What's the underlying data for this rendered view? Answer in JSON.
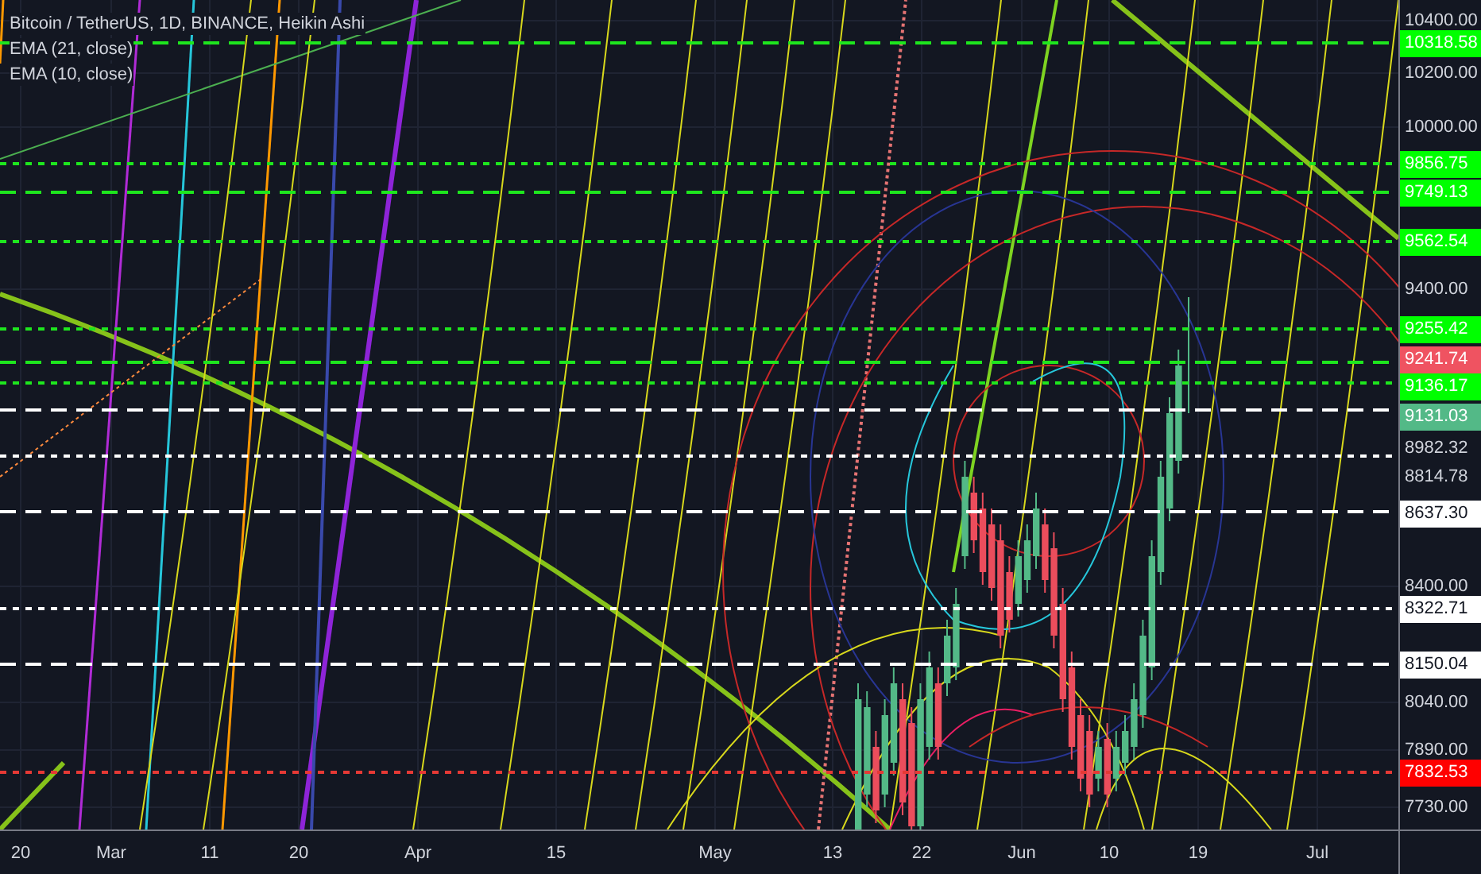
{
  "legend": [
    "Bitcoin / TetherUS, 1D, BINANCE, Heikin Ashi",
    "EMA (21, close)",
    "EMA (10, close)"
  ],
  "levels": [
    {
      "color": "#1ee61e",
      "kind": "thick"
    },
    {
      "color": "#1ee61e",
      "kind": "thin"
    },
    {
      "color": "#1ee61e",
      "kind": "thick"
    },
    {
      "color": "#1ee61e",
      "kind": "thin"
    },
    {
      "color": "#1ee61e",
      "kind": "thin"
    },
    {
      "color": "#1ee61e",
      "kind": "thick"
    },
    {
      "color": "#1ee61e",
      "kind": "thin"
    },
    {
      "color": "#ffffff",
      "kind": "thick"
    },
    {
      "color": "#ffffff",
      "kind": "thin"
    },
    {
      "color": "#ffffff",
      "kind": "thick"
    },
    {
      "color": "#ffffff",
      "kind": "thin"
    },
    {
      "color": "#ffffff",
      "kind": "thick"
    },
    {
      "color": "#e53935",
      "kind": "thin"
    }
  ],
  "price_axis": [
    {
      "text": "10400.00",
      "kind": "tick"
    },
    {
      "text": "10318.58",
      "kind": "marker",
      "color": "#00ff00"
    },
    {
      "text": "10200.00",
      "kind": "tick"
    },
    {
      "text": "10000.00",
      "kind": "tick"
    },
    {
      "text": "9856.75",
      "kind": "marker",
      "color": "#00ff00"
    },
    {
      "text": "9749.13",
      "kind": "marker",
      "color": "#00ff00"
    },
    {
      "text": "9562.54",
      "kind": "marker",
      "color": "#00ff00"
    },
    {
      "text": "9400.00",
      "kind": "tick"
    },
    {
      "text": "9255.42",
      "kind": "marker",
      "color": "#00ff00"
    },
    {
      "text": "9241.74",
      "kind": "marker",
      "color": "#ef5361"
    },
    {
      "text": "9136.17",
      "kind": "marker",
      "color": "#00ff00"
    },
    {
      "text": "9131.03",
      "kind": "marker",
      "color": "#53b987"
    },
    {
      "text": "8982.32",
      "kind": "tick"
    },
    {
      "text": "8814.78",
      "kind": "tick"
    },
    {
      "text": "8637.30",
      "kind": "marker",
      "color": "#ffffff"
    },
    {
      "text": "8400.00",
      "kind": "tick"
    },
    {
      "text": "8322.71",
      "kind": "marker",
      "color": "#ffffff"
    },
    {
      "text": "8150.04",
      "kind": "marker",
      "color": "#ffffff"
    },
    {
      "text": "8040.00",
      "kind": "tick"
    },
    {
      "text": "7890.00",
      "kind": "tick"
    },
    {
      "text": "7832.53",
      "kind": "marker",
      "color": "#ff0000"
    },
    {
      "text": "7730.00",
      "kind": "tick"
    }
  ],
  "time_axis": [
    "20",
    "Mar",
    "11",
    "20",
    "Apr",
    "15",
    "May",
    "13",
    "22",
    "Jun",
    "10",
    "19",
    "Jul"
  ]
}
